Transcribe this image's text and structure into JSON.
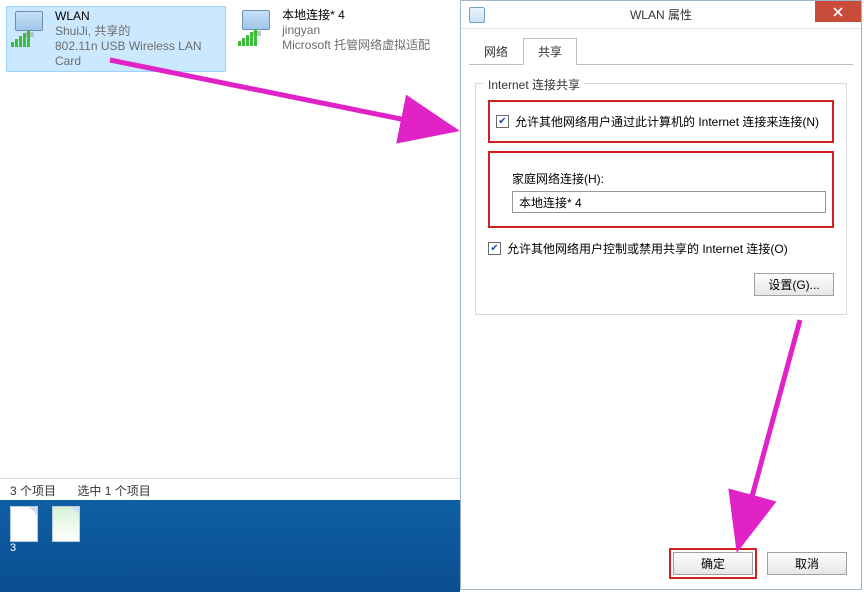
{
  "explorer": {
    "items": [
      {
        "name": "WLAN",
        "line2": "ShuiJi, 共享的",
        "line3": "802.11n USB Wireless LAN Card",
        "selected": true
      },
      {
        "name": "本地连接* 4",
        "line2": "jingyan",
        "line3": "Microsoft 托管网络虚拟适配",
        "selected": false
      }
    ],
    "status_count": "3 个项目",
    "status_sel": "选中 1 个项目"
  },
  "taskbar": {
    "badge": "3"
  },
  "dialog": {
    "title": "WLAN 属性",
    "tabs": {
      "network": "网络",
      "sharing": "共享",
      "active": "sharing"
    },
    "group_legend": "Internet 连接共享",
    "allow_connect": {
      "checked": true,
      "label": "允许其他网络用户通过此计算机的 Internet 连接来连接(N)"
    },
    "home_label": "家庭网络连接(H):",
    "home_value": "本地连接* 4",
    "allow_control": {
      "checked": true,
      "label": "允许其他网络用户控制或禁用共享的 Internet 连接(O)"
    },
    "settings_btn": "设置(G)...",
    "ok": "确定",
    "cancel": "取消"
  }
}
